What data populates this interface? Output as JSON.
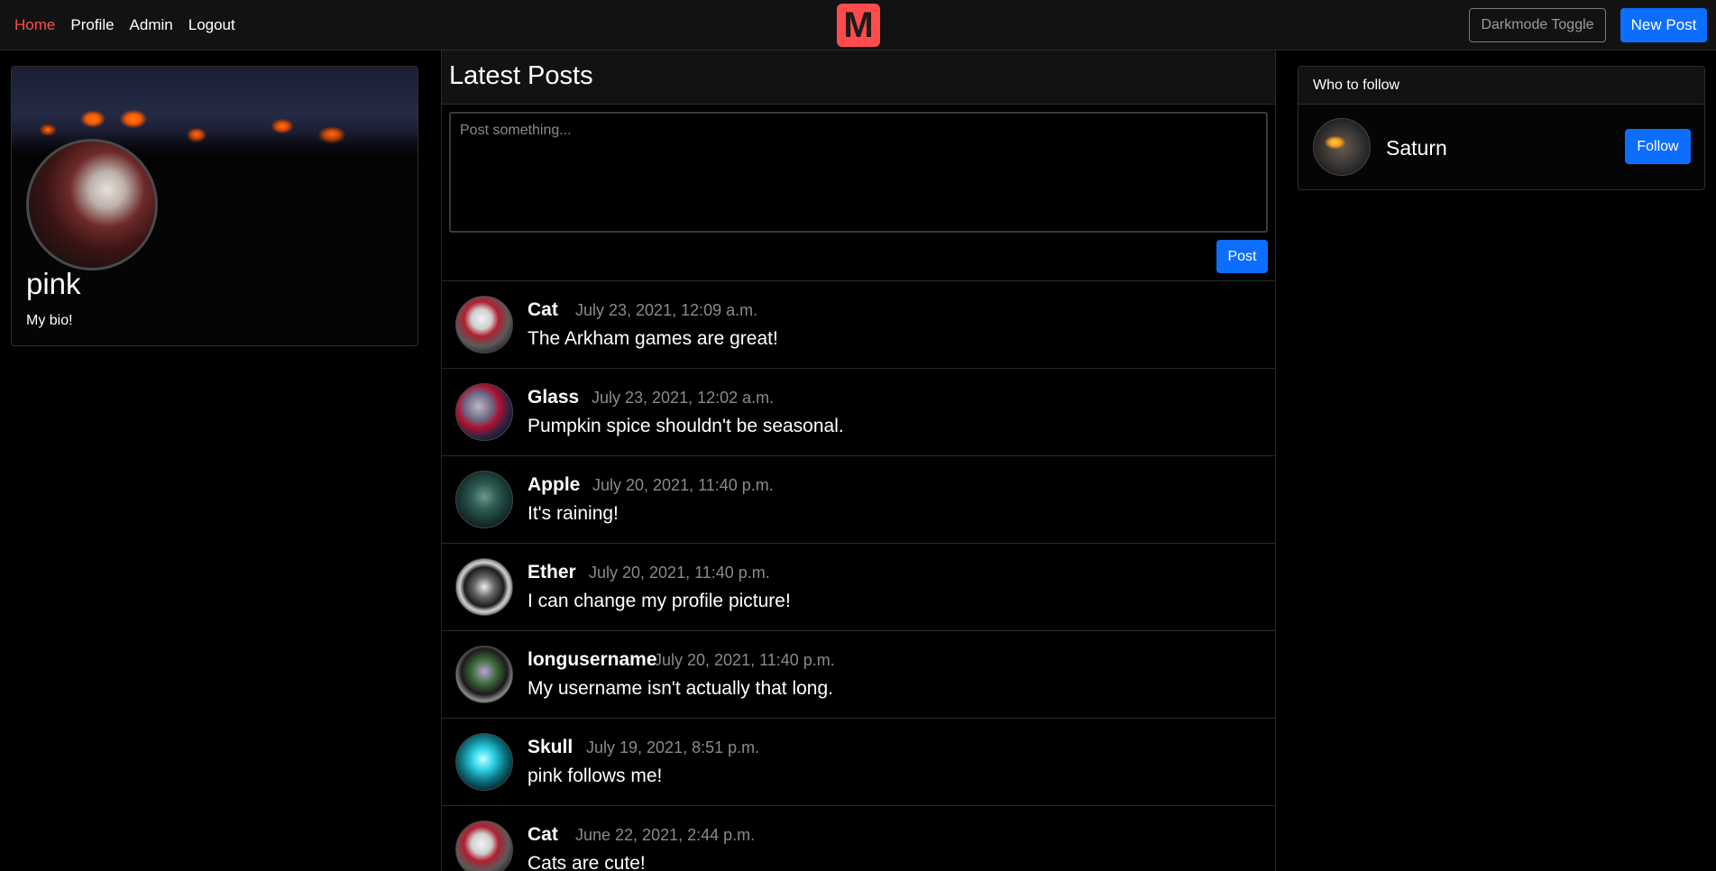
{
  "nav": {
    "links": [
      "Home",
      "Profile",
      "Admin",
      "Logout"
    ],
    "logo_letter": "M",
    "darkmode_label": "Darkmode Toggle",
    "new_post_label": "New Post"
  },
  "profile": {
    "name": "pink",
    "bio": "My bio!"
  },
  "feed": {
    "title": "Latest Posts",
    "composer_placeholder": "Post something...",
    "post_button": "Post",
    "posts": [
      {
        "author": "Cat",
        "time": "July 23, 2021, 12:09 a.m.",
        "body": "The Arkham games are great!"
      },
      {
        "author": "Glass",
        "time": "July 23, 2021, 12:02 a.m.",
        "body": "Pumpkin spice shouldn't be seasonal."
      },
      {
        "author": "Apple",
        "time": "July 20, 2021, 11:40 p.m.",
        "body": "It's raining!"
      },
      {
        "author": "Ether",
        "time": "July 20, 2021, 11:40 p.m.",
        "body": "I can change my profile picture!"
      },
      {
        "author": "longusername",
        "time": "July 20, 2021, 11:40 p.m.",
        "body": "My username isn't actually that long."
      },
      {
        "author": "Skull",
        "time": "July 19, 2021, 8:51 p.m.",
        "body": "pink follows me!"
      },
      {
        "author": "Cat",
        "time": "June 22, 2021, 2:44 p.m.",
        "body": "Cats are cute!"
      }
    ]
  },
  "who_to_follow": {
    "title": "Who to follow",
    "users": [
      {
        "name": "Saturn",
        "button": "Follow"
      }
    ]
  },
  "colors": {
    "accent": "#0d6efd",
    "active_link": "#ff4d4d",
    "logo_bg": "#ff4b4b"
  }
}
